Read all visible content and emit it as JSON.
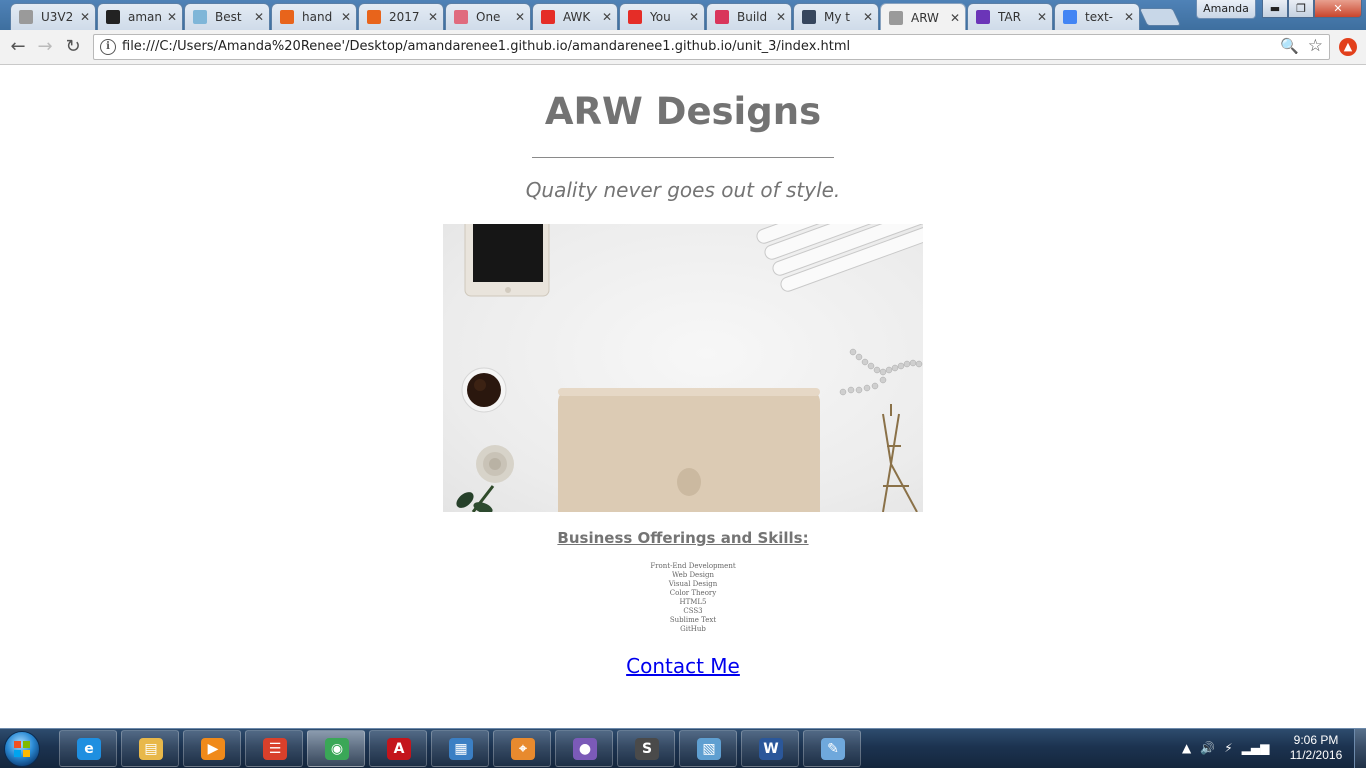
{
  "browser": {
    "tabs": [
      {
        "label": "U3V2",
        "icon": "page-icon",
        "color": "#9a9a9a"
      },
      {
        "label": "aman",
        "icon": "github-icon",
        "color": "#222222"
      },
      {
        "label": "Best",
        "icon": "image-icon",
        "color": "#7fb6d8"
      },
      {
        "label": "hand",
        "icon": "etsy-icon",
        "color": "#e8641b"
      },
      {
        "label": "2017",
        "icon": "etsy-icon",
        "color": "#e8641b"
      },
      {
        "label": "One",
        "icon": "shopify-icon",
        "color": "#e06b7e"
      },
      {
        "label": "AWK",
        "icon": "youtube-icon",
        "color": "#e52d27"
      },
      {
        "label": "You",
        "icon": "youtube-icon",
        "color": "#e52d27"
      },
      {
        "label": "Build",
        "icon": "ga-icon",
        "color": "#d9355b"
      },
      {
        "label": "My t",
        "icon": "tumblr-icon",
        "color": "#36465d"
      },
      {
        "label": "ARW",
        "icon": "page-icon",
        "color": "#9a9a9a"
      },
      {
        "label": "TAR",
        "icon": "circle-icon",
        "color": "#6b35b8"
      },
      {
        "label": "text-",
        "icon": "google-icon",
        "color": "#4285f4"
      }
    ],
    "active_tab": 10,
    "user_name": "Amanda",
    "url": "file:///C:/Users/Amanda%20Renee'/Desktop/amandarenee1.github.io/amandarenee1.github.io/unit_3/index.html",
    "glyphs": {
      "back": "←",
      "forward": "→",
      "reload": "↻",
      "info": "i",
      "zoom": "🔍",
      "star": "☆",
      "close_tab": "✕",
      "minimize": "▬",
      "maximize": "❐",
      "close_window": "✕"
    }
  },
  "page": {
    "title": "ARW Designs",
    "tagline": "Quality never goes out of style.",
    "section_heading": "Business Offerings and Skills:",
    "skills": [
      "Front-End Development",
      "Web Design",
      "Visual Design",
      "Color Theory",
      "HTML5",
      "CSS3",
      "Sublime Text",
      "GitHub"
    ],
    "contact_link": "Contact Me"
  },
  "taskbar": {
    "apps": [
      {
        "name": "internet-explorer-icon",
        "glyph": "e",
        "color": "#1f8fe0"
      },
      {
        "name": "file-explorer-icon",
        "glyph": "▤",
        "color": "#e8b84a"
      },
      {
        "name": "media-player-icon",
        "glyph": "▶",
        "color": "#f08a1a"
      },
      {
        "name": "todoist-icon",
        "glyph": "☰",
        "color": "#d9402b"
      },
      {
        "name": "chrome-icon",
        "glyph": "◉",
        "color": "#3aa757"
      },
      {
        "name": "acrobat-icon",
        "glyph": "A",
        "color": "#c4151c"
      },
      {
        "name": "photo-viewer-icon",
        "glyph": "▦",
        "color": "#3b7fc4"
      },
      {
        "name": "maps-icon",
        "glyph": "⌖",
        "color": "#e88a2e"
      },
      {
        "name": "github-desktop-icon",
        "glyph": "●",
        "color": "#7b5ab8"
      },
      {
        "name": "sublime-text-icon",
        "glyph": "S",
        "color": "#4a4a4a"
      },
      {
        "name": "photos-icon",
        "glyph": "▧",
        "color": "#5f9fd1"
      },
      {
        "name": "word-icon",
        "glyph": "W",
        "color": "#2b579a"
      },
      {
        "name": "paint-icon",
        "glyph": "✎",
        "color": "#6fa8dc"
      }
    ],
    "active_app": 4,
    "clock_time": "9:06 PM",
    "clock_date": "11/2/2016",
    "tray_glyphs": [
      "▲",
      "🔊",
      "⚡",
      "▂▄▆"
    ]
  }
}
